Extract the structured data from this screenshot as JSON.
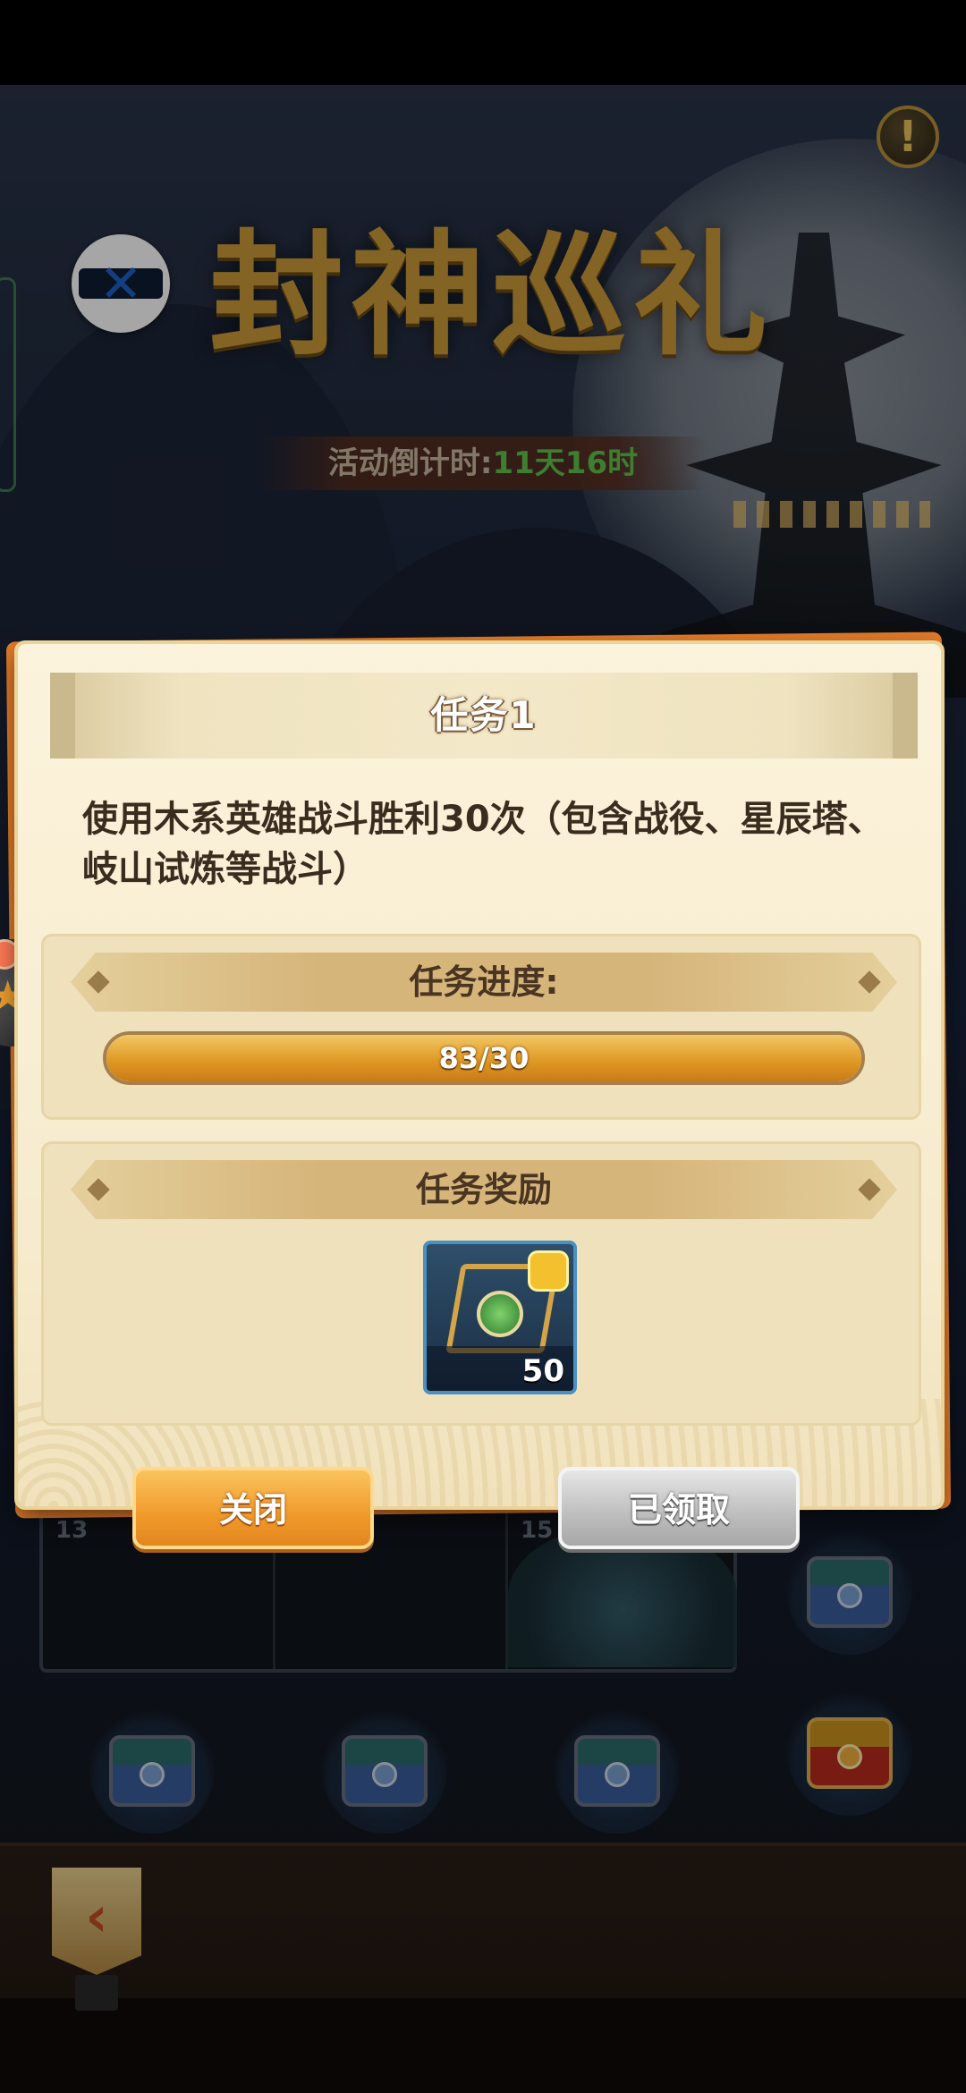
{
  "event": {
    "title": "封神巡礼",
    "countdown_label": "活动倒计时:",
    "countdown_value": "11天16时",
    "help_icon": "!"
  },
  "board": {
    "cell_numbers": [
      "13",
      "15"
    ]
  },
  "dialog": {
    "title": "任务1",
    "description": "使用木系英雄战斗胜利30次（包含战役、星辰塔、岐山试炼等战斗）",
    "progress_header": "任务进度:",
    "progress_text": "83/30",
    "progress_fraction": 1.0,
    "reward_header": "任务奖励",
    "reward_count": "50",
    "reward_icon": "wood-hero-fragment-icon",
    "close_label": "关闭",
    "claimed_label": "已领取"
  },
  "colors": {
    "countdown_value": "#5ec24b",
    "close_button": "#f09a2b",
    "claimed_button": "#bdbdbd",
    "progress_fill": "#e09a24"
  }
}
